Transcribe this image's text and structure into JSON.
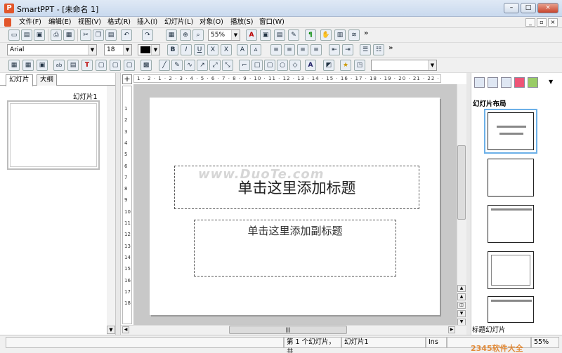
{
  "window": {
    "title": "SmartPPT - [未命名 1]",
    "app_icon_letter": "P"
  },
  "window_controls": {
    "minimize": "–",
    "maximize": "□",
    "close": "×"
  },
  "menu": [
    "文件(F)",
    "编辑(E)",
    "视图(V)",
    "格式(R)",
    "插入(I)",
    "幻灯片(L)",
    "对象(O)",
    "播放(S)",
    "窗口(W)"
  ],
  "mdi_controls": {
    "minimize": "_",
    "restore": "▫",
    "close": "×"
  },
  "toolbar": {
    "zoom": "55%",
    "font_name": "Arial",
    "font_size": "18",
    "more": "»",
    "arrow": "▼"
  },
  "format_buttons": {
    "bold": "B",
    "italic": "I",
    "underline": "U",
    "strike": "X",
    "shadow": "X",
    "grow": "A",
    "shrink": "A"
  },
  "draw_text": {
    "text_t": "T",
    "ab": "ab",
    "text_a": "A"
  },
  "left_panel": {
    "tabs": [
      "幻灯片",
      "大纲"
    ],
    "slide_label": "幻灯片1"
  },
  "ruler": {
    "h_ticks": [
      "1",
      "2",
      "1",
      "2",
      "3",
      "4",
      "5",
      "6",
      "7",
      "8",
      "9",
      "10",
      "11",
      "12",
      "13",
      "14",
      "15",
      "16",
      "17",
      "18",
      "19",
      "20",
      "21",
      "22",
      "23",
      "24",
      "25"
    ],
    "v_ticks": [
      "1",
      "2",
      "3",
      "4",
      "5",
      "6",
      "7",
      "8",
      "9",
      "10",
      "11",
      "12",
      "13",
      "14",
      "15",
      "16",
      "17",
      "18"
    ],
    "corner": "+"
  },
  "slide": {
    "title_placeholder": "单击这里添加标题",
    "subtitle_placeholder": "单击这里添加副标题",
    "watermark": "www.DuoTe.com"
  },
  "hscroll_grip": "|||",
  "right_panel": {
    "heading": "幻灯片布局",
    "caption": "标题幻灯片",
    "more": "▼"
  },
  "status": {
    "slide_info": "第 1 个幻灯片，共",
    "slide_name": "幻灯片1",
    "mode": "Ins",
    "zoom": "55%"
  },
  "brand_watermark": "2345软件大全",
  "colors": {
    "accent": "#6cb0e8",
    "font_color": "#000000"
  }
}
